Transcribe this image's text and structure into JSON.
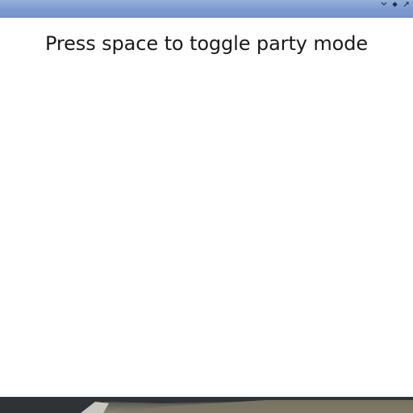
{
  "window": {
    "message": "Press space to toggle party mode",
    "controls": [
      {
        "icon": "chevron-down-icon"
      },
      {
        "icon": "diamond-icon"
      },
      {
        "icon": "close-icon"
      }
    ]
  },
  "colors": {
    "titlebar": "#7d9ad0",
    "content_bg": "#ffffff",
    "text": "#1a1a1a"
  }
}
